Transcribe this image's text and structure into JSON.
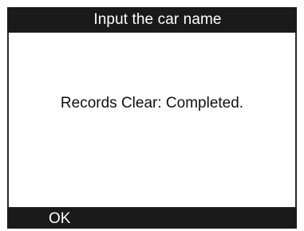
{
  "header": {
    "title": "Input the car name"
  },
  "main": {
    "message": "Records Clear: Completed."
  },
  "footer": {
    "ok_label": "OK"
  },
  "colors": {
    "bar_background": "#1a1a1a",
    "bar_text": "#ffffff",
    "content_background": "#ffffff",
    "content_text": "#111111"
  }
}
